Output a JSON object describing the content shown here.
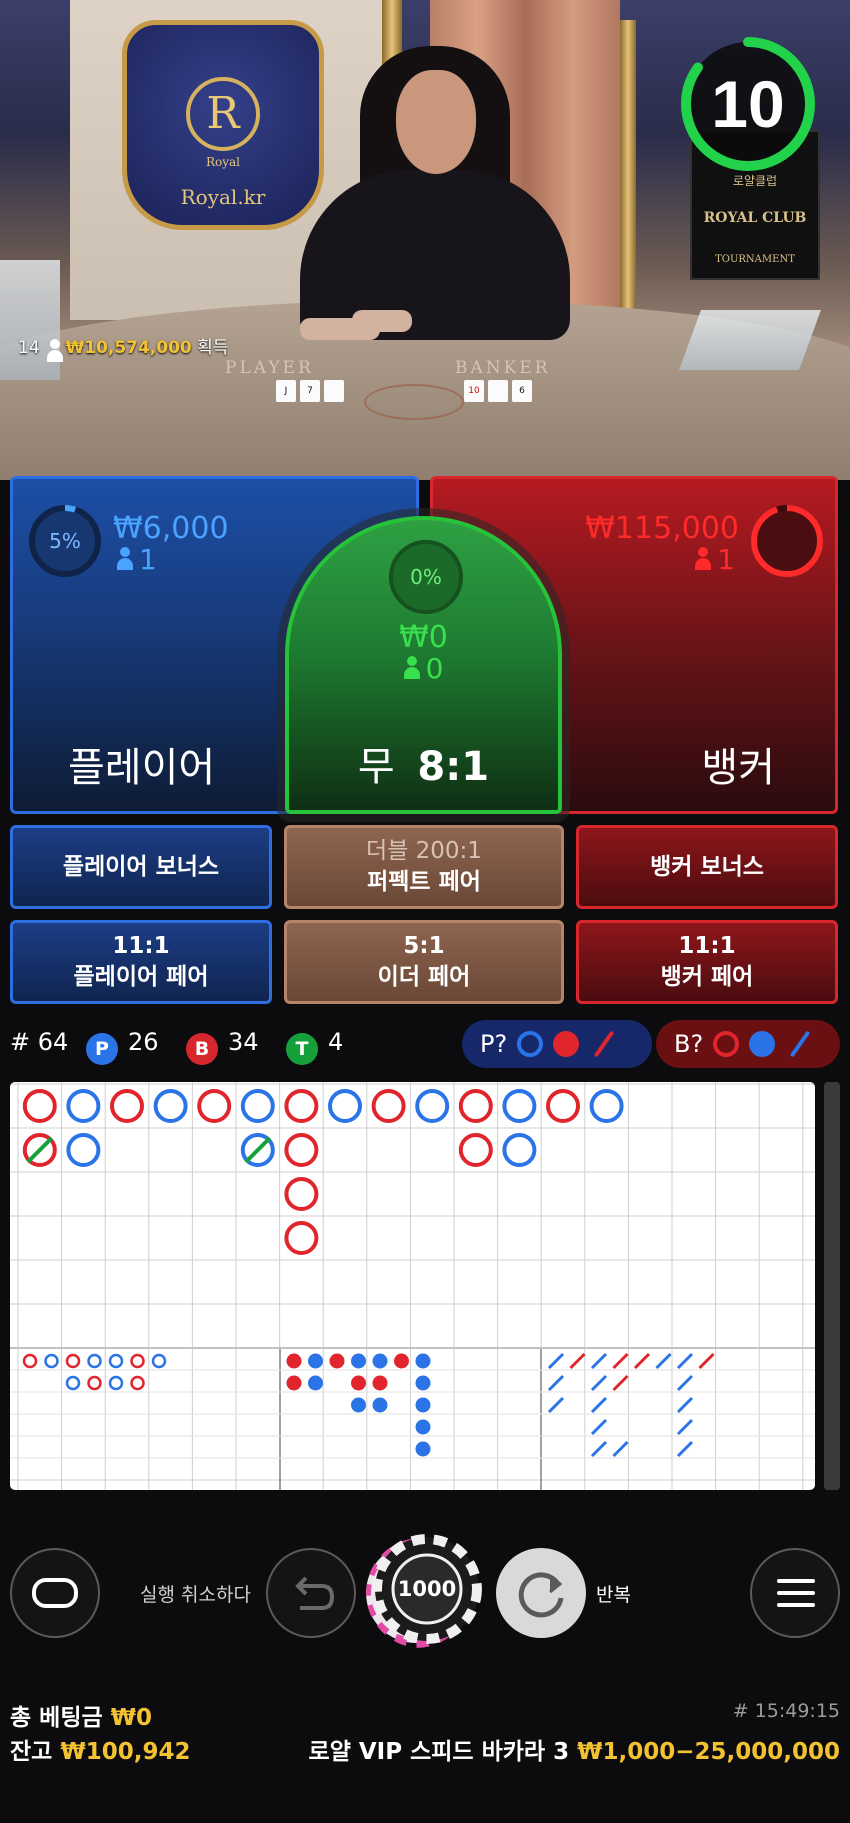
{
  "video": {
    "logo_letter": "R",
    "logo_sub": "Royal",
    "logo_text": "Royal.kr",
    "player_label": "PLAYER",
    "banker_label": "BANKER",
    "club_title": "ROYAL CLUB",
    "club_sub": "로얄클럽",
    "club_tournament": "TOURNAMENT",
    "win_count": "14",
    "win_amount": "₩10,574,000",
    "win_suffix": "획득",
    "timer": "10",
    "timer_fraction": 0.85,
    "player_cards": [
      "J",
      "7"
    ],
    "banker_cards": [
      "10",
      "6"
    ]
  },
  "bets": {
    "player": {
      "label": "플레이어",
      "pct": "5%",
      "pct_value": 0.05,
      "amount": "₩6,000",
      "count": "1",
      "color": "#4aa3ff"
    },
    "tie": {
      "label": "무",
      "odds": "8:1",
      "pct": "0%",
      "amount": "₩0",
      "count": "0",
      "color": "#39e04d"
    },
    "banker": {
      "label": "뱅커",
      "pct": "95%",
      "pct_value": 0.95,
      "amount": "₩115,000",
      "count": "1",
      "color": "#ff2a2a"
    }
  },
  "side_bets": {
    "player_bonus": "플레이어 보너스",
    "perfect_pair_top": "더블 200:1",
    "perfect_pair": "퍼펙트 페어",
    "banker_bonus": "뱅커 보너스",
    "player_pair_odds": "11:1",
    "player_pair": "플레이어 페어",
    "either_pair_odds": "5:1",
    "either_pair": "이더 페어",
    "banker_pair_odds": "11:1",
    "banker_pair": "뱅커 페어"
  },
  "stats": {
    "hash": "#",
    "rounds": "64",
    "p_letter": "P",
    "player_wins": "26",
    "b_letter": "B",
    "banker_wins": "34",
    "t_letter": "T",
    "ties": "4",
    "player_predict": "P?",
    "banker_predict": "B?"
  },
  "roadmap": {
    "big_road": [
      [
        "B",
        "B/T"
      ],
      [
        "P",
        "P"
      ],
      [
        "B"
      ],
      [
        "P"
      ],
      [
        "B"
      ],
      [
        "P",
        "P/T"
      ],
      [
        "B",
        "B",
        "B",
        "B"
      ],
      [
        "P"
      ],
      [
        "B"
      ],
      [
        "P"
      ],
      [
        "B",
        "B"
      ],
      [
        "P",
        "P"
      ],
      [
        "B"
      ],
      [
        "P"
      ]
    ]
  },
  "controls": {
    "undo_label": "실행 취소하다",
    "chip_value": "1000",
    "repeat_label": "반복"
  },
  "footer": {
    "total_bet_label": "총 베팅금",
    "total_bet": "₩0",
    "balance_label": "잔고",
    "balance": "₩100,942",
    "round_id": "# 15:49:15",
    "table_name": "로얄 VIP 스피드 바카라 3",
    "limits": "₩1,000−25,000,000"
  },
  "colors": {
    "player_blue": "#2e6ee0",
    "banker_red": "#d7262c",
    "tie_green": "#25c23a",
    "gold": "#f2c232"
  }
}
